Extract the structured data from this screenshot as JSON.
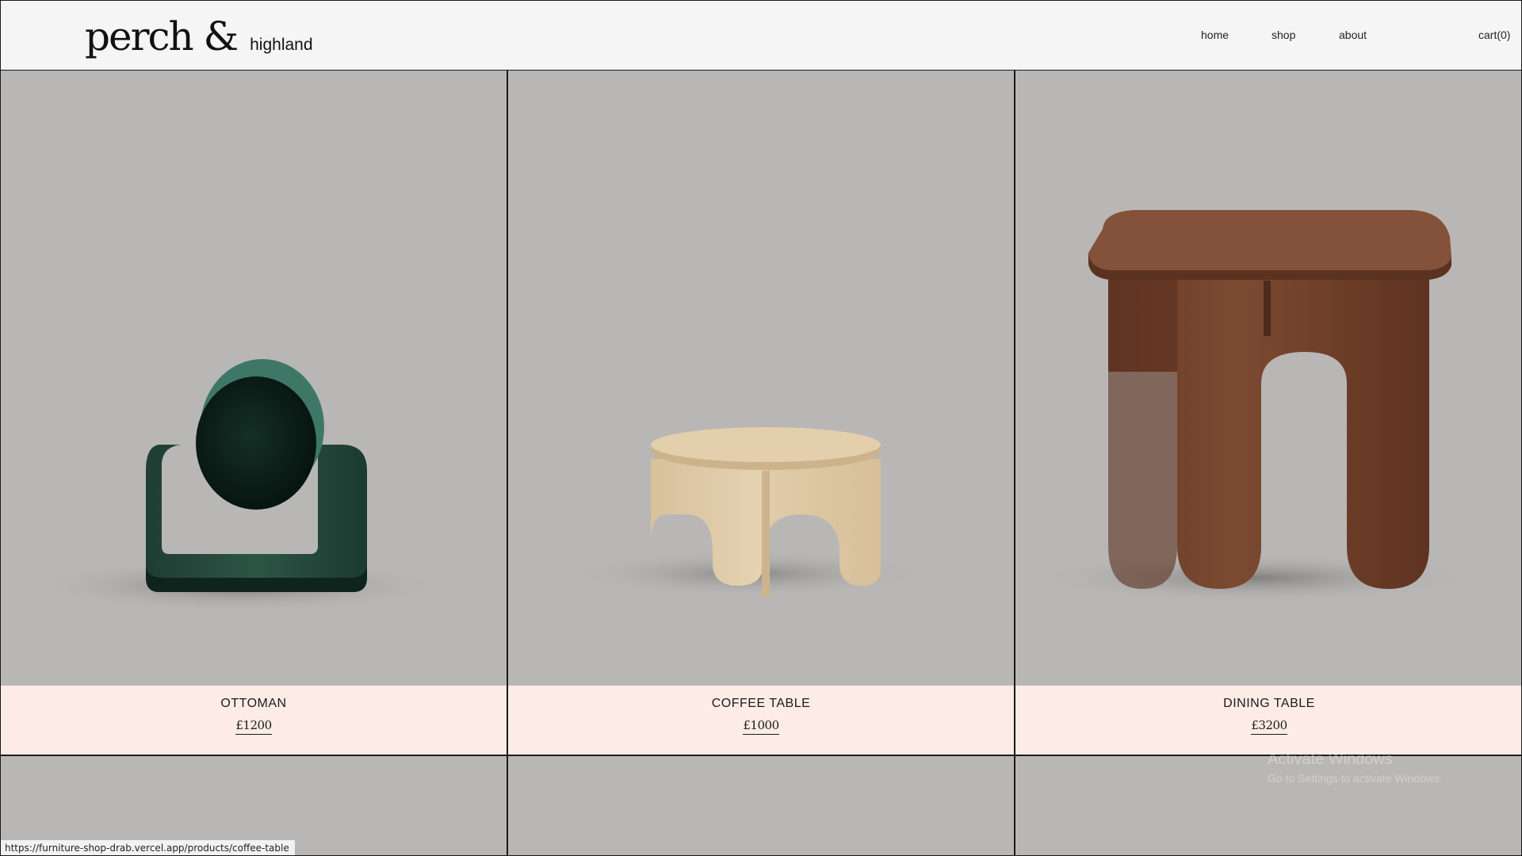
{
  "header": {
    "logo_main": "perch &",
    "logo_sub": "highland",
    "nav": [
      {
        "label": "home"
      },
      {
        "label": "shop"
      },
      {
        "label": "about"
      }
    ],
    "cart_label": "cart(0)"
  },
  "products": [
    {
      "name": "OTTOMAN",
      "price": "£1200",
      "image": "green-velvet-ottoman"
    },
    {
      "name": "COFFEE TABLE",
      "price": "£1000",
      "image": "light-wood-coffee-table"
    },
    {
      "name": "DINING TABLE",
      "price": "£3200",
      "image": "walnut-dining-table"
    }
  ],
  "colors": {
    "image_bg": "#b8b7b5",
    "info_bg": "#fdece6",
    "header_bg": "#f5f5f5",
    "border": "#1a1a1a"
  },
  "watermark": {
    "title": "Activate Windows",
    "subtitle": "Go to Settings to activate Windows."
  },
  "statusbar": {
    "url": "https://furniture-shop-drab.vercel.app/products/coffee-table"
  }
}
